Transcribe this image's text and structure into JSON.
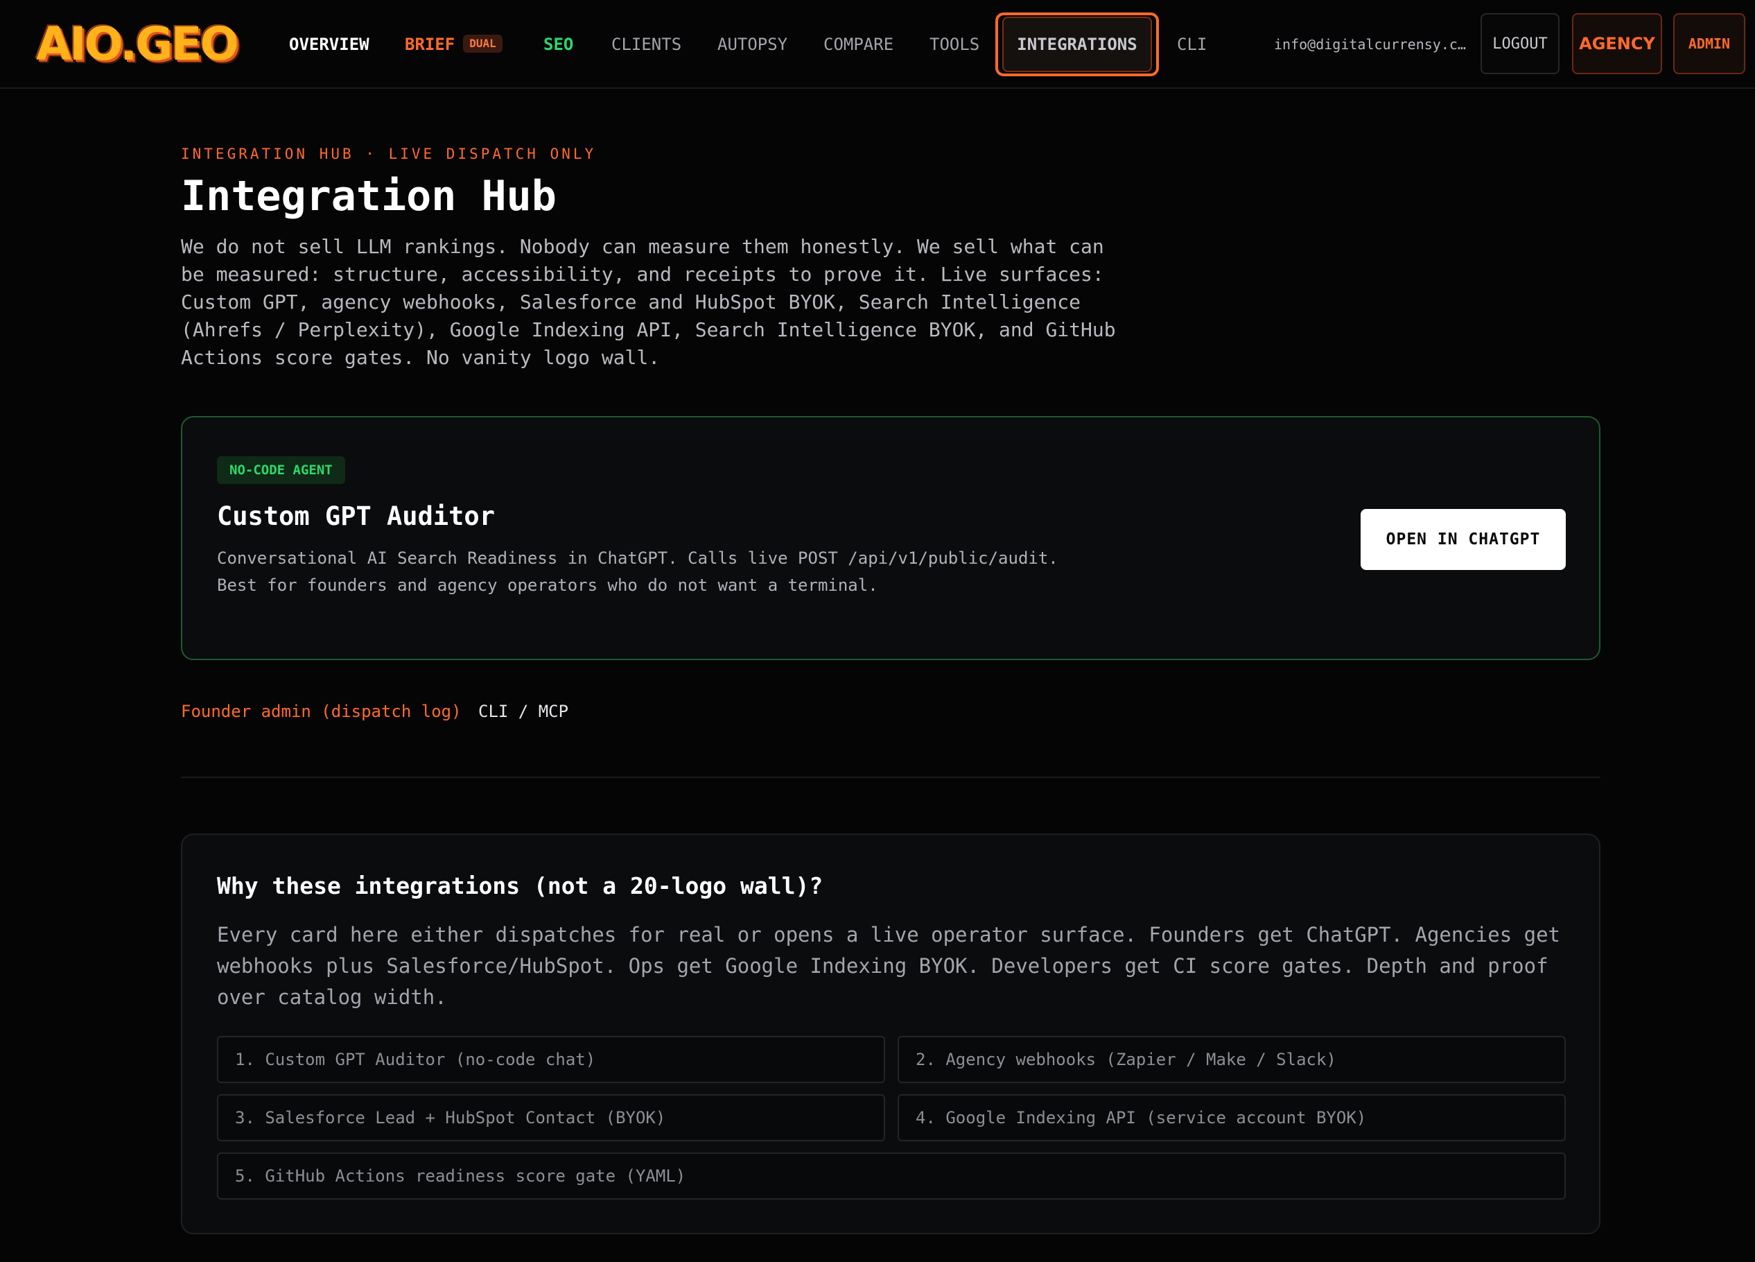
{
  "brand": {
    "logo_text": "AIO.GEO"
  },
  "nav": {
    "overview": "OVERVIEW",
    "brief": "BRIEF",
    "brief_badge": "DUAL",
    "seo": "SEO",
    "clients": "CLIENTS",
    "autopsy": "AUTOPSY",
    "compare": "COMPARE",
    "tools": "TOOLS",
    "integrations": "INTEGRATIONS",
    "cli": "CLI",
    "email": "info@digitalcurrensy.c…",
    "logout": "LOGOUT",
    "agency": "AGENCY",
    "admin": "ADMIN"
  },
  "hero": {
    "eyebrow": "INTEGRATION HUB · LIVE DISPATCH ONLY",
    "title": "Integration Hub",
    "intro": "We do not sell LLM rankings. Nobody can measure them honestly. We sell what can be measured: structure, accessibility, and receipts to prove it. Live surfaces: Custom GPT, agency webhooks, Salesforce and HubSpot BYOK, Search Intelligence (Ahrefs / Perplexity), Google Indexing API, Search Intelligence BYOK, and GitHub Actions score gates. No vanity logo wall."
  },
  "gpt_card": {
    "badge": "NO-CODE AGENT",
    "title": "Custom GPT Auditor",
    "description": "Conversational AI Search Readiness in ChatGPT. Calls live POST /api/v1/public/audit. Best for founders and agency operators who do not want a terminal.",
    "button": "OPEN IN CHATGPT"
  },
  "links": {
    "founder_admin": "Founder admin (dispatch log)",
    "cli_mcp": "CLI / MCP"
  },
  "why": {
    "title": "Why these integrations (not a 20-logo wall)?",
    "body": "Every card here either dispatches for real or opens a live operator surface. Founders get ChatGPT. Agencies get webhooks plus Salesforce/HubSpot. Ops get Google Indexing BYOK. Developers get CI score gates. Depth and proof over catalog width.",
    "items": [
      "1. Custom GPT Auditor (no-code chat)",
      "2. Agency webhooks (Zapier / Make / Slack)",
      "3. Salesforce Lead + HubSpot Contact (BYOK)",
      "4. Google Indexing API (service account BYOK)",
      "5. GitHub Actions readiness score gate (YAML)"
    ]
  },
  "colors": {
    "accent_orange": "#ff6a2b",
    "accent_green": "#2bd86b",
    "background": "#050506",
    "card": "#0b0c0e"
  }
}
